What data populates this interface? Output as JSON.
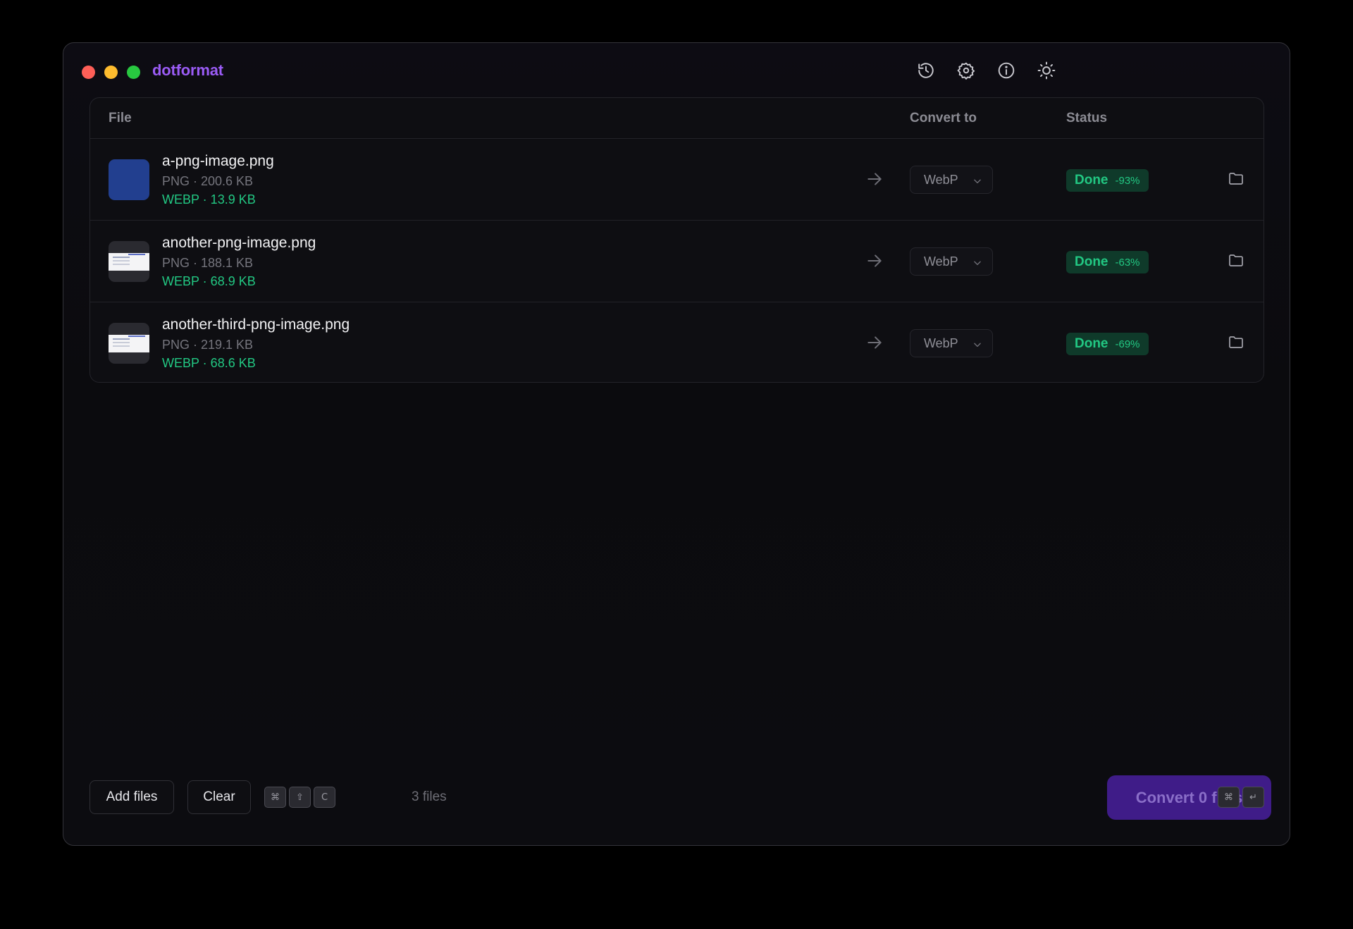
{
  "app": {
    "title": "dotformat"
  },
  "toolbar": {
    "icons": [
      "history-icon",
      "settings-icon",
      "info-icon",
      "theme-sun-icon"
    ]
  },
  "table": {
    "headers": {
      "file": "File",
      "convert_to": "Convert to",
      "status": "Status"
    },
    "rows": [
      {
        "name": "a-png-image.png",
        "source": "PNG · 200.6 KB",
        "output": "WEBP · 13.9 KB",
        "target_format": "WebP",
        "status": "Done",
        "reduction": "-93%",
        "thumbnail": "solid-blue"
      },
      {
        "name": "another-png-image.png",
        "source": "PNG · 188.1 KB",
        "output": "WEBP · 68.9 KB",
        "target_format": "WebP",
        "status": "Done",
        "reduction": "-63%",
        "thumbnail": "document"
      },
      {
        "name": "another-third-png-image.png",
        "source": "PNG · 219.1 KB",
        "output": "WEBP · 68.6 KB",
        "target_format": "WebP",
        "status": "Done",
        "reduction": "-69%",
        "thumbnail": "document"
      }
    ]
  },
  "footer": {
    "add_files_label": "Add files",
    "clear_label": "Clear",
    "clear_shortcut": [
      "⌘",
      "⇧",
      "C"
    ],
    "file_count": "3 files",
    "convert_label": "Convert 0 files",
    "convert_shortcut": [
      "⌘",
      "↵"
    ]
  },
  "colors": {
    "accent": "#9b5cf6",
    "success": "#22c883",
    "convert_button": "#3f1c88"
  }
}
